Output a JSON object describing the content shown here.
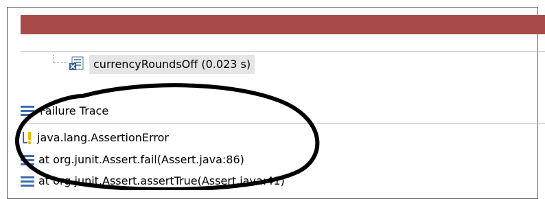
{
  "junit_view": {
    "status_bar_color": "#a84a48",
    "test_tree": {
      "item": {
        "label": "currencyRoundsOff (0.023 s)",
        "icon": "test-method-icon"
      }
    },
    "failure_trace": {
      "header_icon": "stack-trace-icon",
      "title": "Failure Trace",
      "lines": [
        {
          "icon": "warning-icon",
          "text": "java.lang.AssertionError"
        },
        {
          "icon": "stack-frame-icon",
          "text": "at org.junit.Assert.fail(Assert.java:86)"
        },
        {
          "icon": "stack-frame-icon",
          "text": "at org.junit.Assert.assertTrue(Assert.java:41)"
        }
      ]
    }
  },
  "annotation": {
    "shape": "ellipse",
    "color": "#000000"
  }
}
